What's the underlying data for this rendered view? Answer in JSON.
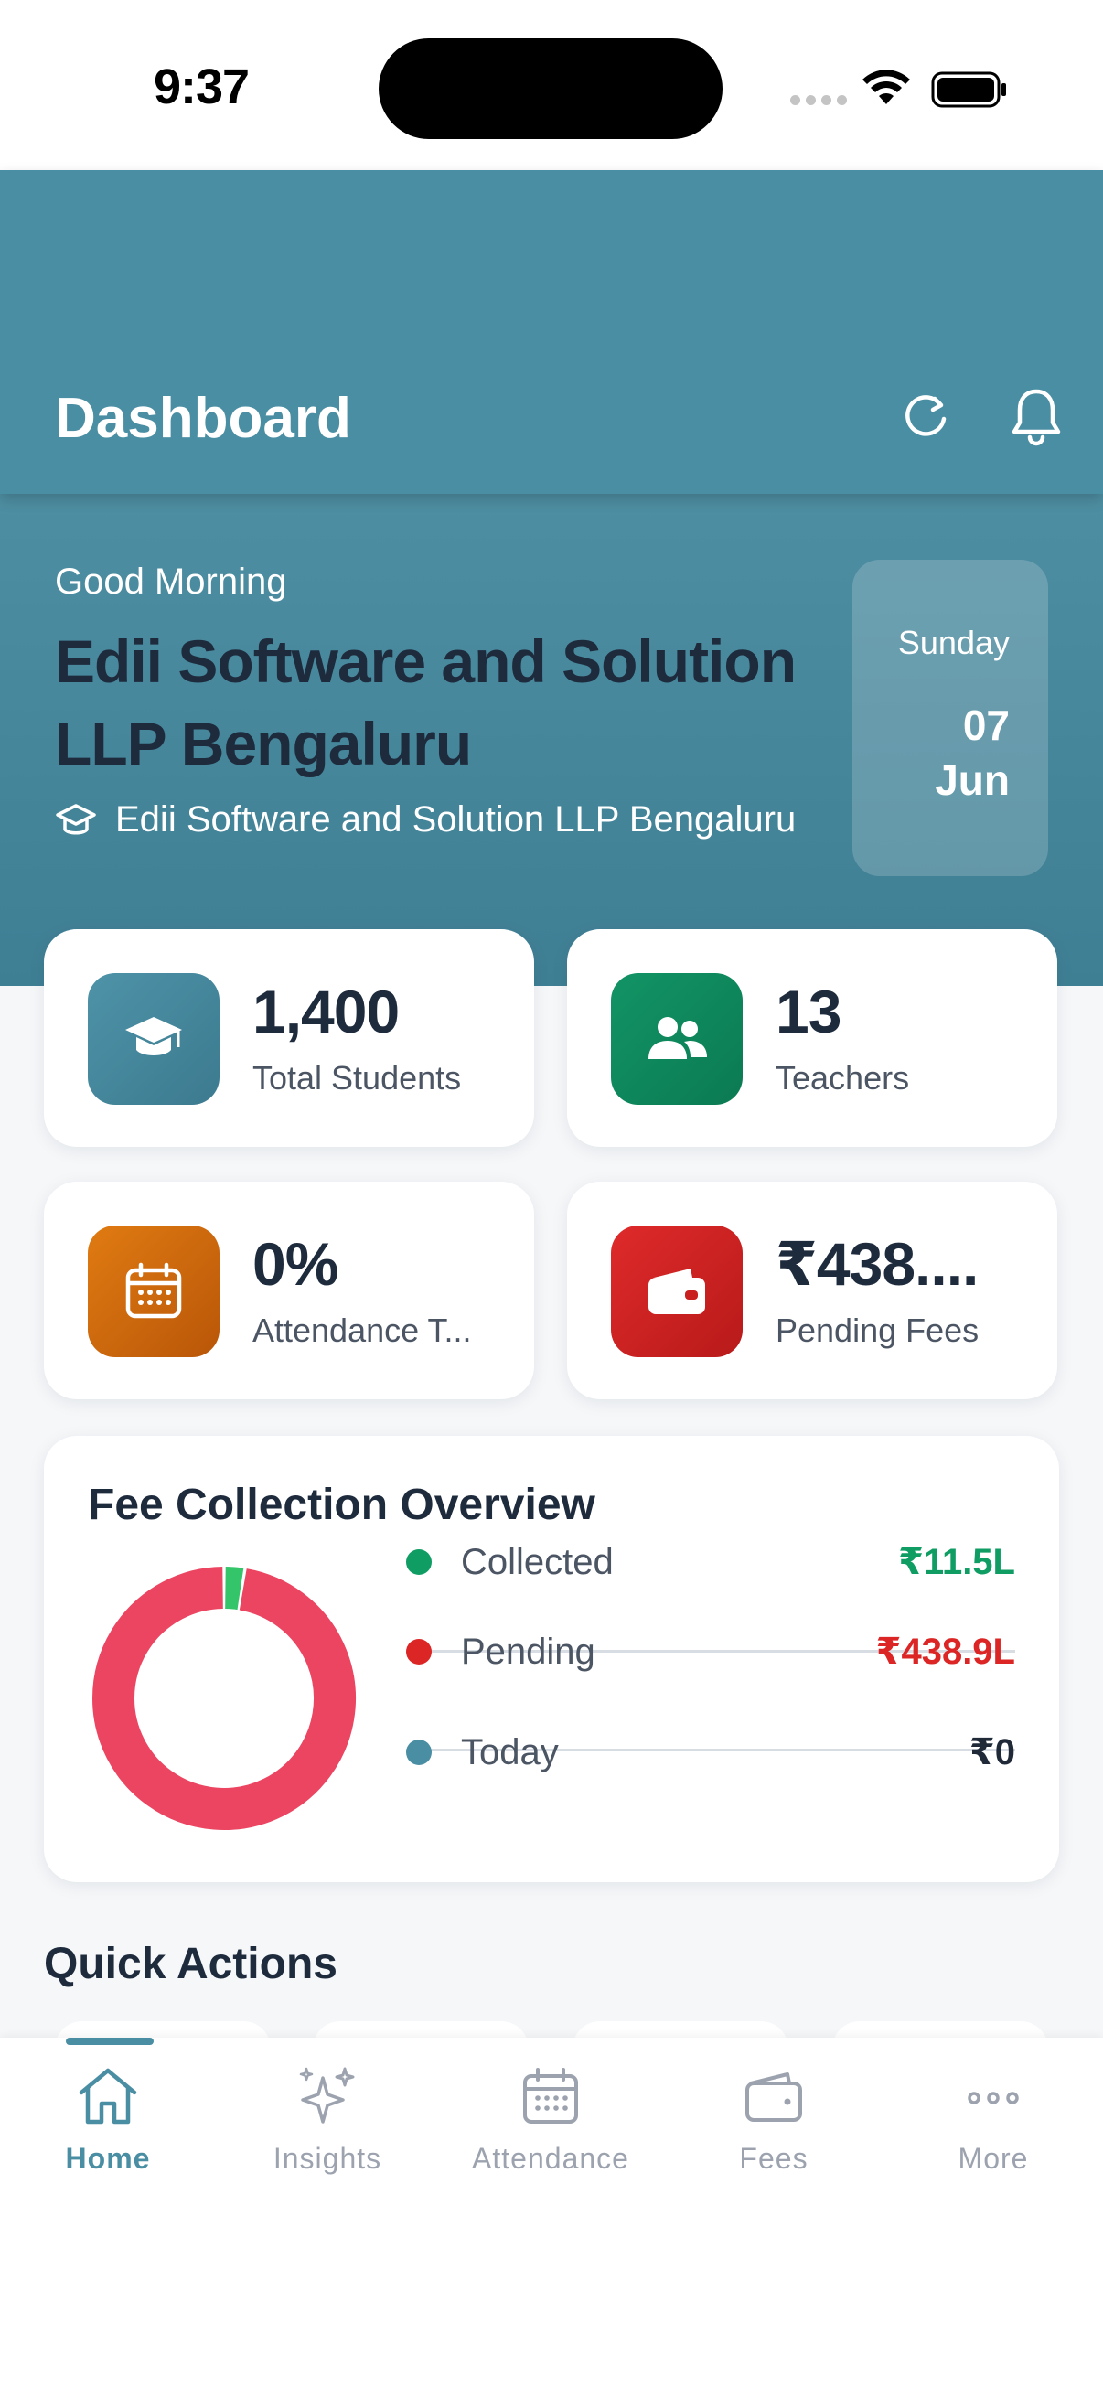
{
  "status_bar": {
    "time": "9:37"
  },
  "header": {
    "title": "Dashboard"
  },
  "hero": {
    "greeting": "Good Morning",
    "org_name": "Edii Software and Solution LLP Bengaluru",
    "org_sub": "Edii Software and Solution LLP Bengaluru",
    "date": {
      "day": "Sunday",
      "num": "07",
      "month": "Jun"
    }
  },
  "stats": [
    {
      "value": "1,400",
      "label": "Total Students",
      "icon": "graduation-cap-icon",
      "color": "#4a8ea3"
    },
    {
      "value": "13",
      "label": "Teachers",
      "icon": "users-icon",
      "color": "#0f8f63"
    },
    {
      "value": "0%",
      "label": "Attendance T...",
      "icon": "calendar-icon",
      "color": "#d9730d"
    },
    {
      "value": "₹438....",
      "label": "Pending Fees",
      "icon": "wallet-icon",
      "color": "#d62828"
    }
  ],
  "fee_overview": {
    "title": "Fee Collection Overview",
    "rows": [
      {
        "label": "Collected",
        "value": "₹11.5L",
        "dot_color": "#0f9d63",
        "value_color": "#0f9d63"
      },
      {
        "label": "Pending",
        "value": "₹438.9L",
        "dot_color": "#dc2626",
        "value_color": "#dc2626"
      },
      {
        "label": "Today",
        "value": "₹0",
        "dot_color": "#4a8ea3",
        "value_color": "#1f2937"
      }
    ],
    "chart": {
      "collected": 11.5,
      "pending": 438.9,
      "collected_color": "#34c46a",
      "pending_color": "#ec4561"
    }
  },
  "quick_actions": {
    "title": "Quick Actions"
  },
  "nav": [
    {
      "label": "Home",
      "icon": "home-icon",
      "active": true
    },
    {
      "label": "Insights",
      "icon": "sparkles-icon",
      "active": false
    },
    {
      "label": "Attendance",
      "icon": "calendar-icon",
      "active": false
    },
    {
      "label": "Fees",
      "icon": "wallet-icon",
      "active": false
    },
    {
      "label": "More",
      "icon": "more-icon",
      "active": false
    }
  ]
}
